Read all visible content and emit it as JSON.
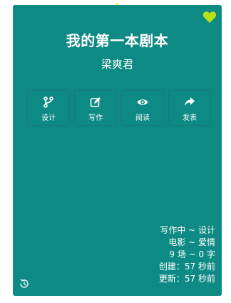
{
  "script": {
    "title": "我的第一本剧本",
    "author": "梁爽君"
  },
  "actions": [
    {
      "label": "设计",
      "icon": "branch-icon"
    },
    {
      "label": "写作",
      "icon": "edit-icon"
    },
    {
      "label": "阅读",
      "icon": "eye-icon"
    },
    {
      "label": "发表",
      "icon": "share-icon"
    }
  ],
  "info": {
    "status": "写作中 ~ 设计",
    "genre": "电影 ~ 爱情",
    "stats": "9 场 ~ 0 字",
    "created": "创建：57 秒前",
    "updated": "更新：57 秒前"
  },
  "colors": {
    "card": "#0e8a84",
    "accent": "#e6f21a",
    "heart": "#b6e11a"
  }
}
